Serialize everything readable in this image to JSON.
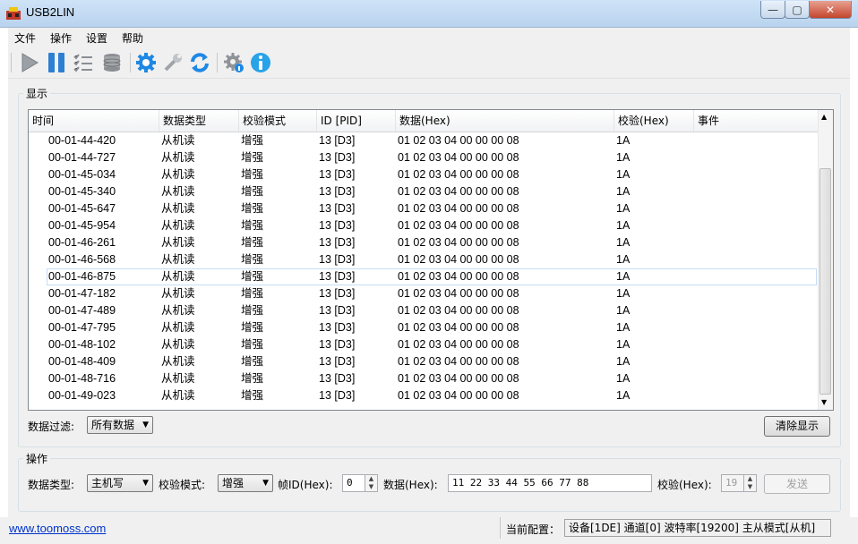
{
  "window": {
    "title": "USB2LIN",
    "minimize": "—",
    "maximize": "▢",
    "close": "✕"
  },
  "menu": {
    "items": [
      "文件",
      "操作",
      "设置",
      "帮助"
    ]
  },
  "toolbar": {
    "icons": [
      "play-icon",
      "pause-icon",
      "checklist-icon",
      "database-icon",
      "gear-icon",
      "wrench-icon",
      "refresh-icon",
      "settings-info-icon",
      "info-icon"
    ]
  },
  "display": {
    "group_label": "显示",
    "columns": [
      "时间",
      "数据类型",
      "校验模式",
      "ID [PID]",
      "数据(Hex)",
      "校验(Hex)",
      "事件"
    ],
    "rows": [
      [
        "00-01-44-420",
        "从机读",
        "增强",
        "13 [D3]",
        "01 02 03 04 00 00 00 08",
        "1A",
        ""
      ],
      [
        "00-01-44-727",
        "从机读",
        "增强",
        "13 [D3]",
        "01 02 03 04 00 00 00 08",
        "1A",
        ""
      ],
      [
        "00-01-45-034",
        "从机读",
        "增强",
        "13 [D3]",
        "01 02 03 04 00 00 00 08",
        "1A",
        ""
      ],
      [
        "00-01-45-340",
        "从机读",
        "增强",
        "13 [D3]",
        "01 02 03 04 00 00 00 08",
        "1A",
        ""
      ],
      [
        "00-01-45-647",
        "从机读",
        "增强",
        "13 [D3]",
        "01 02 03 04 00 00 00 08",
        "1A",
        ""
      ],
      [
        "00-01-45-954",
        "从机读",
        "增强",
        "13 [D3]",
        "01 02 03 04 00 00 00 08",
        "1A",
        ""
      ],
      [
        "00-01-46-261",
        "从机读",
        "增强",
        "13 [D3]",
        "01 02 03 04 00 00 00 08",
        "1A",
        ""
      ],
      [
        "00-01-46-568",
        "从机读",
        "增强",
        "13 [D3]",
        "01 02 03 04 00 00 00 08",
        "1A",
        ""
      ],
      [
        "00-01-46-875",
        "从机读",
        "增强",
        "13 [D3]",
        "01 02 03 04 00 00 00 08",
        "1A",
        ""
      ],
      [
        "00-01-47-182",
        "从机读",
        "增强",
        "13 [D3]",
        "01 02 03 04 00 00 00 08",
        "1A",
        ""
      ],
      [
        "00-01-47-489",
        "从机读",
        "增强",
        "13 [D3]",
        "01 02 03 04 00 00 00 08",
        "1A",
        ""
      ],
      [
        "00-01-47-795",
        "从机读",
        "增强",
        "13 [D3]",
        "01 02 03 04 00 00 00 08",
        "1A",
        ""
      ],
      [
        "00-01-48-102",
        "从机读",
        "增强",
        "13 [D3]",
        "01 02 03 04 00 00 00 08",
        "1A",
        ""
      ],
      [
        "00-01-48-409",
        "从机读",
        "增强",
        "13 [D3]",
        "01 02 03 04 00 00 00 08",
        "1A",
        ""
      ],
      [
        "00-01-48-716",
        "从机读",
        "增强",
        "13 [D3]",
        "01 02 03 04 00 00 00 08",
        "1A",
        ""
      ],
      [
        "00-01-49-023",
        "从机读",
        "增强",
        "13 [D3]",
        "01 02 03 04 00 00 00 08",
        "1A",
        ""
      ]
    ],
    "selected_row": 8,
    "filter_label": "数据过滤:",
    "filter_value": "所有数据",
    "clear_button": "清除显示"
  },
  "operation": {
    "group_label": "操作",
    "data_type_label": "数据类型:",
    "data_type_value": "主机写",
    "check_mode_label": "校验模式:",
    "check_mode_value": "增强",
    "frame_id_label": "帧ID(Hex):",
    "frame_id_value": "0",
    "data_label": "数据(Hex):",
    "data_value": "11 22 33 44 55 66 77 88",
    "checksum_label": "校验(Hex):",
    "checksum_value": "19",
    "send_button": "发送"
  },
  "status": {
    "link": "www.toomoss.com",
    "config_label": "当前配置：",
    "config_value": "设备[1DE] 通道[0] 波特率[19200] 主从模式[从机]"
  }
}
